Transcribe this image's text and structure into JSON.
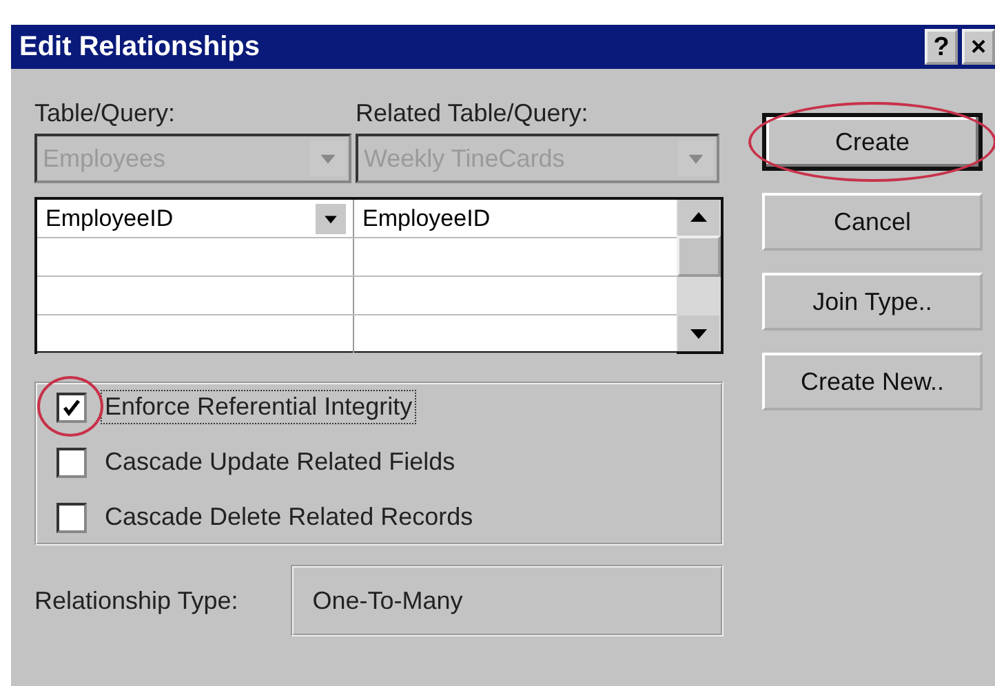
{
  "window": {
    "title": "Edit Relationships",
    "help_button": "?",
    "close_button": "×"
  },
  "table_query": {
    "label": "Table/Query:",
    "value": "Employees",
    "disabled": true
  },
  "related_table_query": {
    "label": "Related Table/Query:",
    "value": "Weekly TineCards",
    "disabled": true
  },
  "join_fields": [
    {
      "field": "EmployeeID",
      "related_field": "EmployeeID"
    }
  ],
  "options": [
    {
      "label": "Enforce Referential Integrity",
      "checked": true,
      "focused": true,
      "highlighted": true
    },
    {
      "label": "Cascade Update Related Fields",
      "checked": false,
      "focused": false,
      "highlighted": false
    },
    {
      "label": "Cascade Delete Related Records",
      "checked": false,
      "focused": false,
      "highlighted": false
    }
  ],
  "relationship_type": {
    "label": "Relationship Type:",
    "value": "One-To-Many"
  },
  "buttons": [
    {
      "label": "Create",
      "default": true,
      "highlighted": true
    },
    {
      "label": "Cancel",
      "default": false,
      "highlighted": false
    },
    {
      "label": "Join Type..",
      "default": false,
      "highlighted": false
    },
    {
      "label": "Create New..",
      "default": false,
      "highlighted": false
    }
  ]
}
